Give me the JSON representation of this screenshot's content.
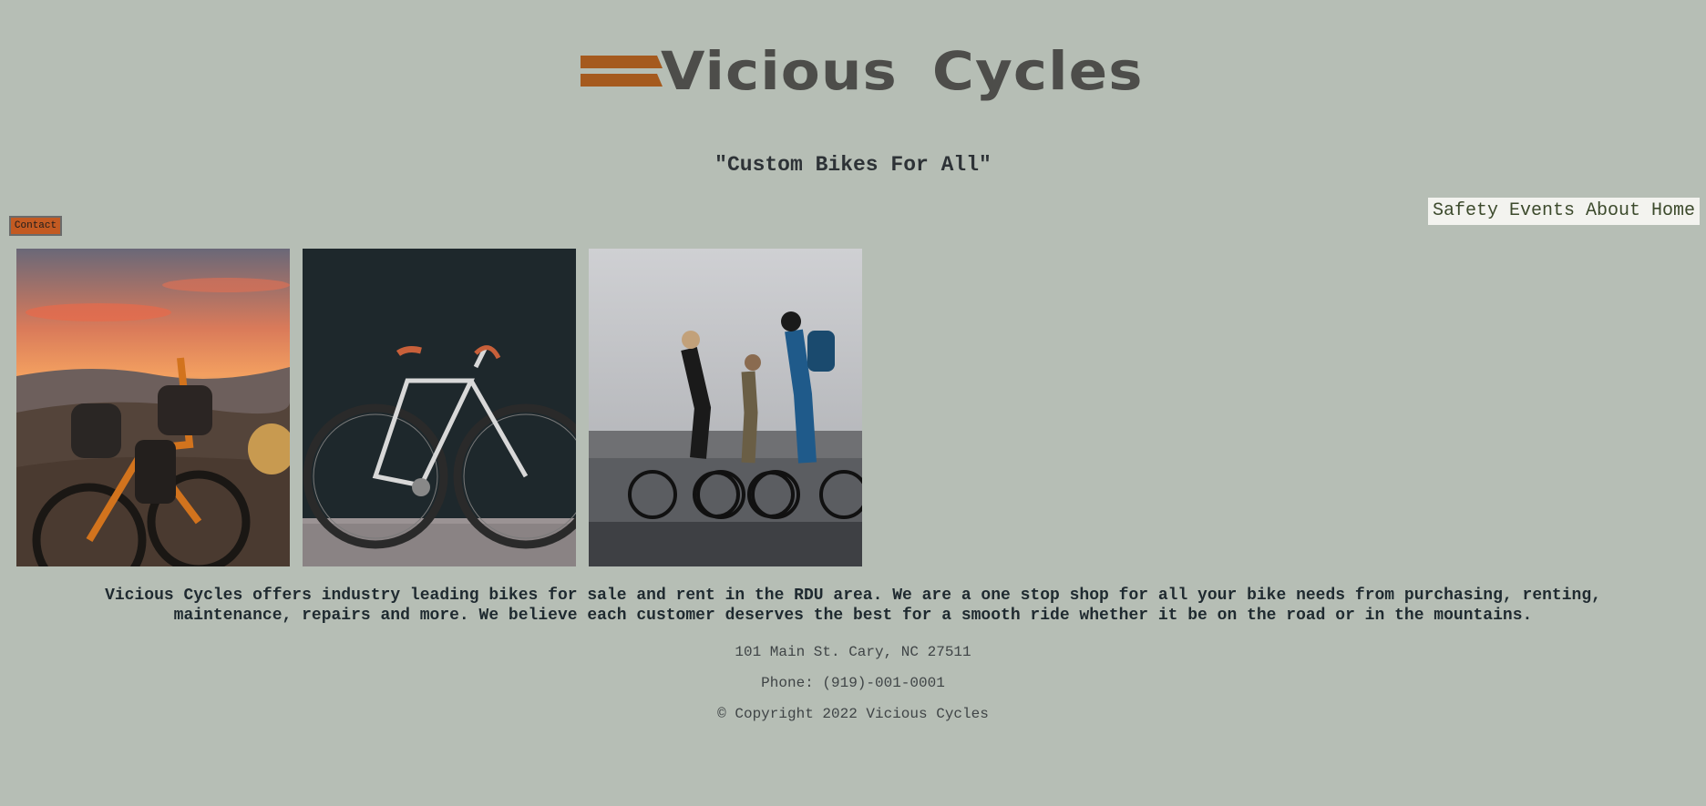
{
  "brand": {
    "name": "Vicious Cycles",
    "accent_color": "#a55a1e",
    "text_color": "#4d4d4a",
    "background": "#b6beb5"
  },
  "tagline": "\"Custom Bikes For All\"",
  "nav": {
    "items": [
      {
        "label": "Safety"
      },
      {
        "label": "Events"
      },
      {
        "label": "About"
      },
      {
        "label": "Home"
      }
    ]
  },
  "contact_button": {
    "label": "Contact",
    "color": "#c35a22"
  },
  "photos": [
    {
      "subject": "bikepacking-bike-sunset-photo"
    },
    {
      "subject": "white-road-bike-photo"
    },
    {
      "subject": "cyclists-riding-photo"
    }
  ],
  "description": "Vicious Cycles offers industry leading bikes for sale and rent in the RDU area. We are a one stop shop for all your bike needs from purchasing, renting, maintenance, repairs and more. We believe each customer deserves the best for a smooth ride whether it be on the road or in the mountains.",
  "footer": {
    "address": "101 Main St. Cary, NC 27511",
    "phone": "Phone: (919)-001-0001",
    "copyright": "© Copyright 2022 Vicious Cycles"
  }
}
